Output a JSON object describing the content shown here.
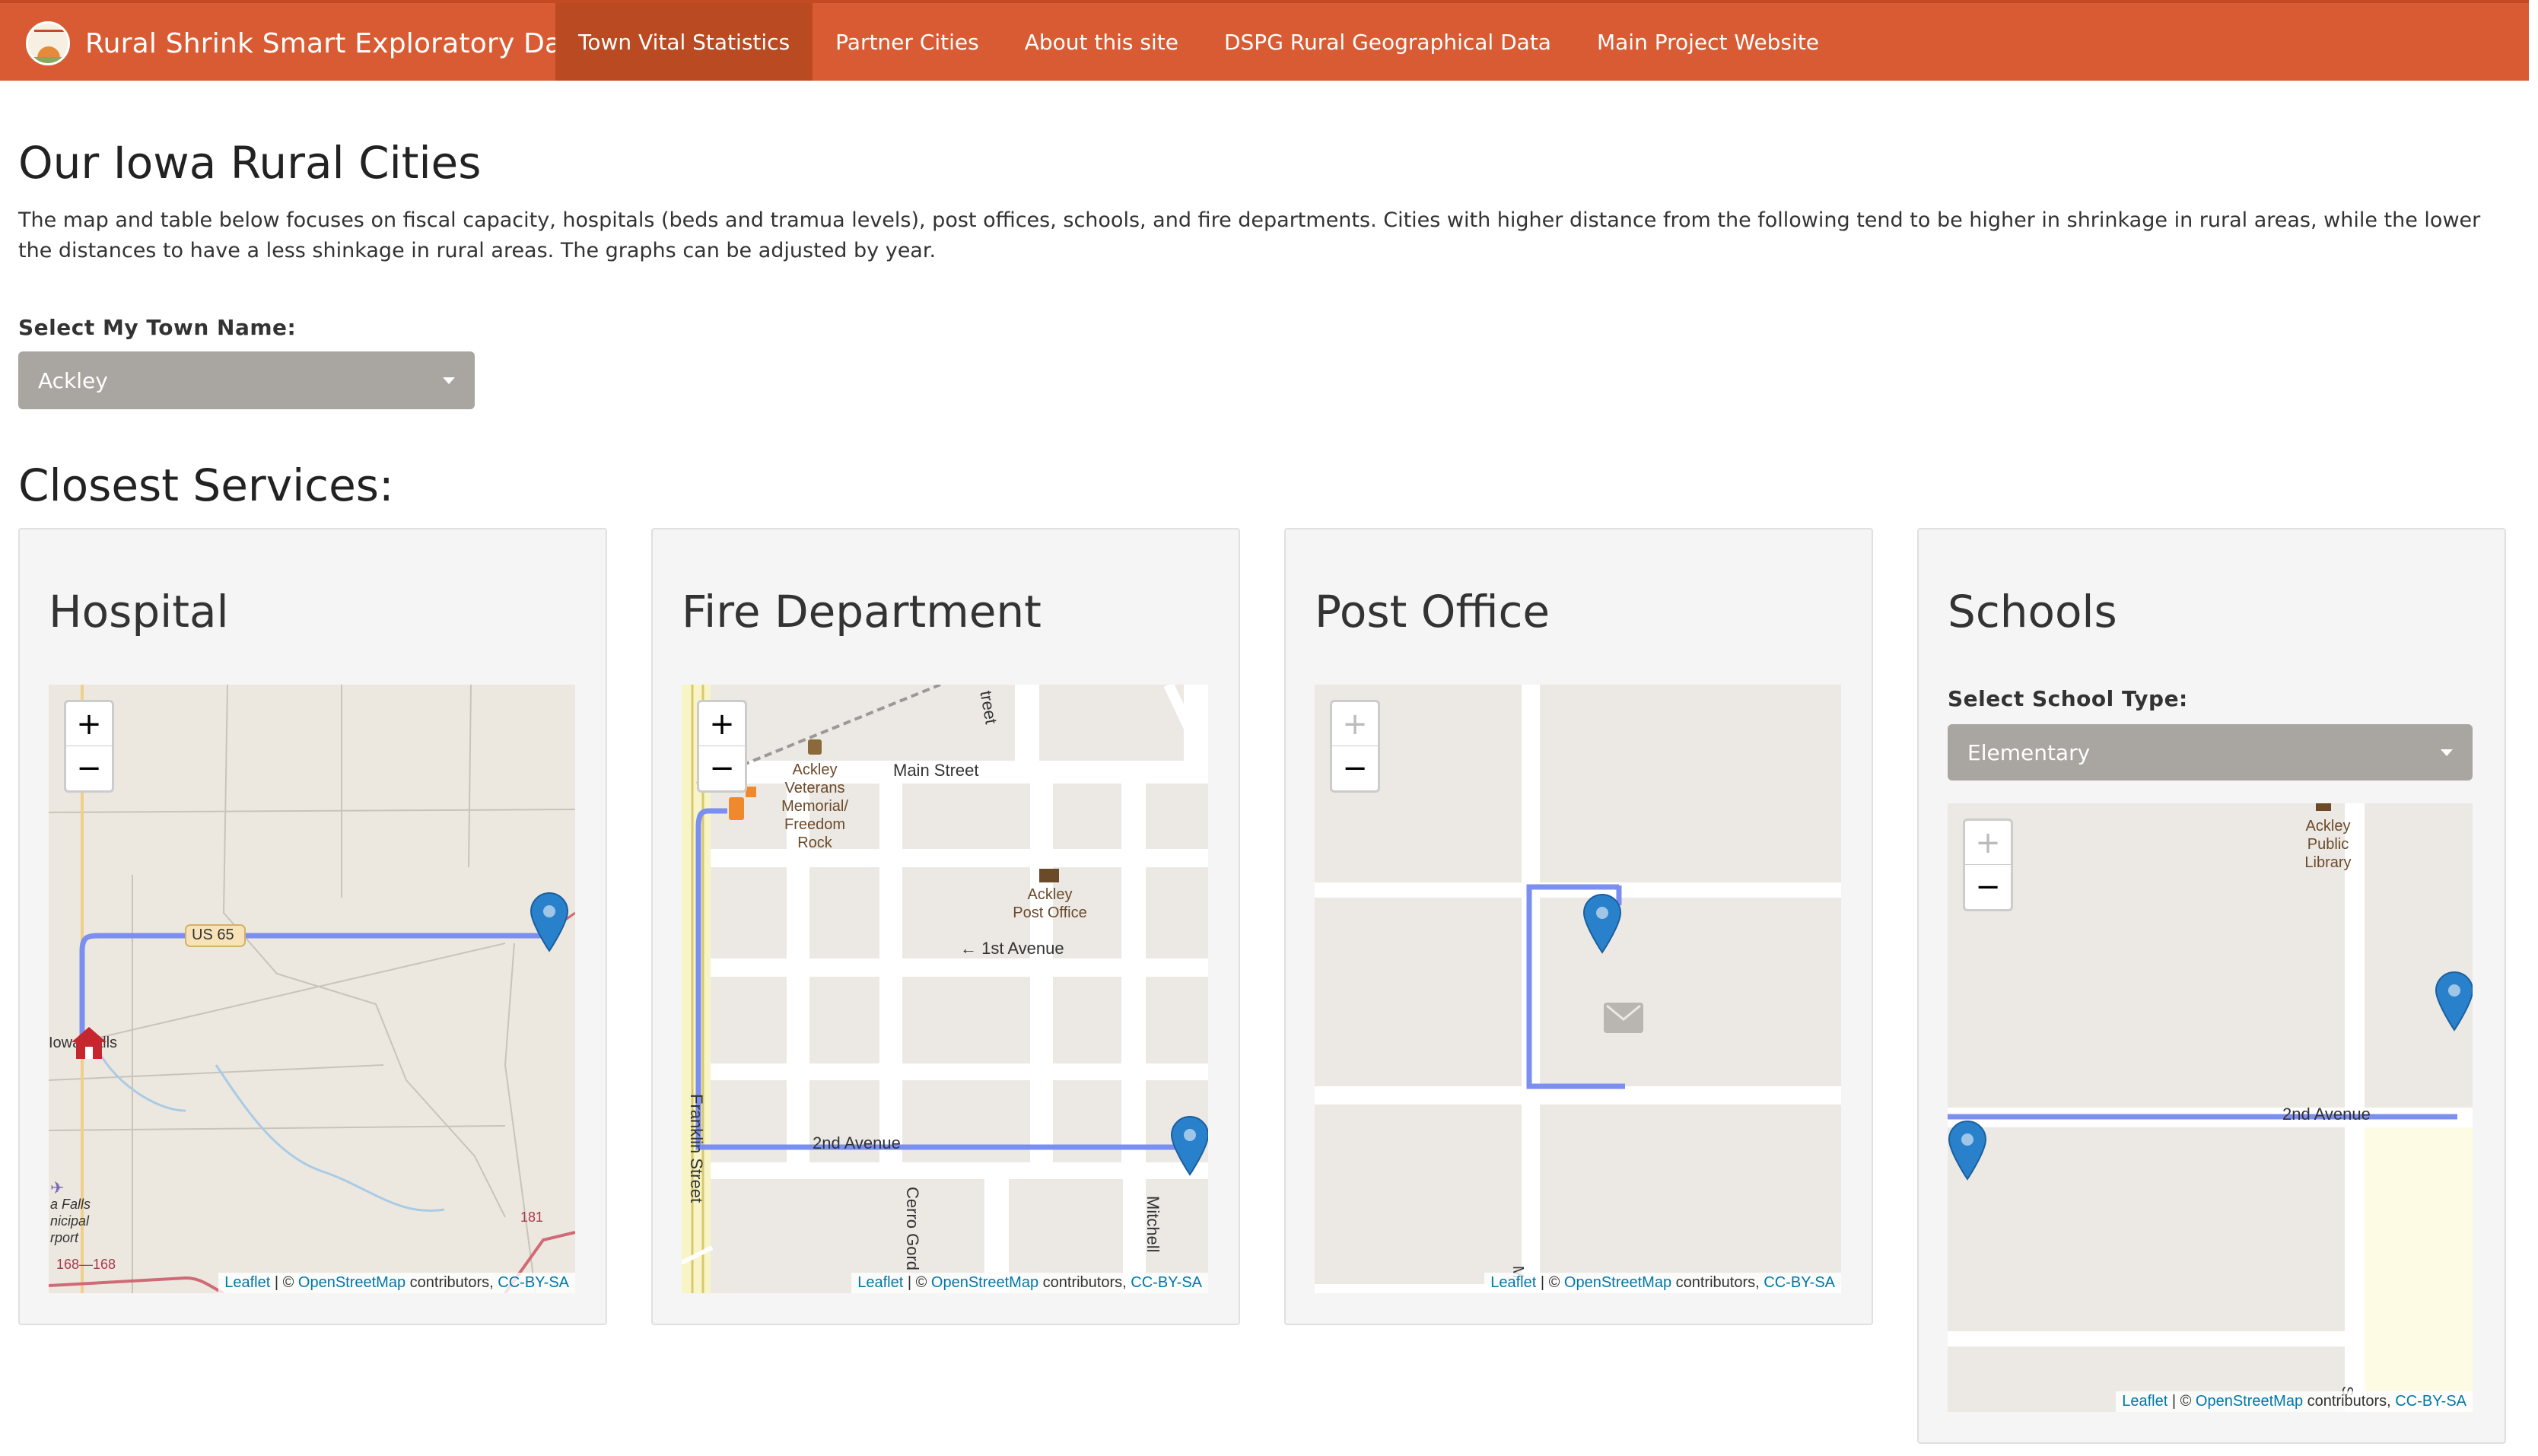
{
  "navbar": {
    "brand": "Rural Shrink Smart Exploratory Data",
    "items": [
      {
        "label": "Town Vital Statistics",
        "active": true
      },
      {
        "label": "Partner Cities",
        "active": false
      },
      {
        "label": "About this site",
        "active": false
      },
      {
        "label": "DSPG Rural Geographical Data",
        "active": false
      },
      {
        "label": "Main Project Website",
        "active": false
      }
    ],
    "color": "#d95b33"
  },
  "page": {
    "title": "Our Iowa Rural Cities",
    "intro": "The map and table below focuses on fiscal capacity, hospitals (beds and tramua levels), post offices, schools, and fire departments. Cities with higher distance from the following tend to be higher in shrinkage in rural areas, while the lower the distances to have a less shinkage in rural areas. The graphs can be adjusted by year.",
    "town_label": "Select My Town Name:",
    "town_value": "Ackley",
    "services_title": "Closest Services:"
  },
  "panels": {
    "hospital": {
      "title": "Hospital"
    },
    "fire": {
      "title": "Fire Department"
    },
    "post": {
      "title": "Post Office"
    },
    "schools": {
      "title": "Schools",
      "select_label": "Select School Type:",
      "select_value": "Elementary"
    }
  },
  "map_text": {
    "zoom_in": "+",
    "zoom_out": "−",
    "hospital": {
      "road": "US 65",
      "town": "Iowa Falls",
      "airport": "a Falls\nnicipal\nrport",
      "route168": "168—168",
      "route181": "181"
    },
    "fire": {
      "main_street": "Main Street",
      "memorial": "Ackley\nVeterans\nMemorial/\nFreedom\nRock",
      "post_office": "Ackley\nPost Office",
      "first_ave": "← 1st Avenue",
      "second_ave": "2nd Avenue",
      "franklin": "Franklin Street",
      "cerro": "Cerro Gord",
      "mitchell": "Mitchell",
      "street_top": "treet"
    },
    "post": {
      "m": "M"
    },
    "schools": {
      "library": "Ackley\nPublic\nLibrary",
      "second_ave": "2nd Avenue",
      "s": "S"
    }
  },
  "attribution": {
    "leaflet": "Leaflet",
    "sep": " | © ",
    "osm": "OpenStreetMap",
    "contrib": " contributors, ",
    "license": "CC-BY-SA"
  },
  "colors": {
    "route": "#7b8ff0",
    "marker": "#2a81cb",
    "accent": "#d95b33"
  }
}
